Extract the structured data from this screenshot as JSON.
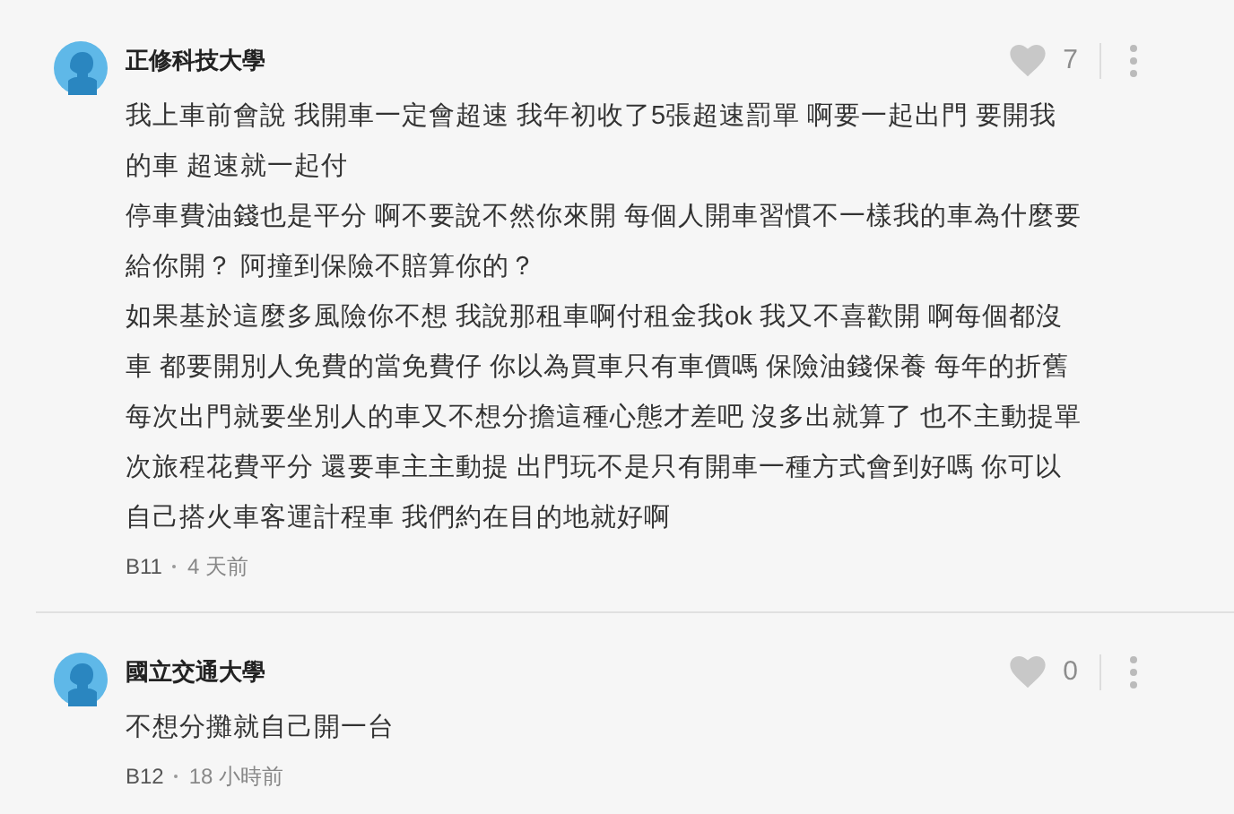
{
  "comments": [
    {
      "author": "正修科技大學",
      "likes": "7",
      "liked": false,
      "lines": [
        "我上車前會說 我開車一定會超速 我年初收了5張超速罰單 啊要一起出門 要開我",
        "的車 超速就一起付",
        "停車費油錢也是平分 啊不要說不然你來開 每個人開車習慣不一樣我的車為什麼要",
        "給你開？ 阿撞到保險不賠算你的？",
        "如果基於這麼多風險你不想 我說那租車啊付租金我ok 我又不喜歡開 啊每個都沒",
        "車 都要開別人免費的當免費仔 你以為買車只有車價嗎 保險油錢保養 每年的折舊",
        "每次出門就要坐別人的車又不想分擔這種心態才差吧 沒多出就算了 也不主動提單",
        "次旅程花費平分 還要車主主動提 出門玩不是只有開車一種方式會到好嗎 你可以",
        "自己搭火車客運計程車 我們約在目的地就好啊"
      ],
      "floor": "B11",
      "time": "4 天前"
    },
    {
      "author": "國立交通大學",
      "likes": "0",
      "liked": false,
      "lines": [
        "不想分攤就自己開一台"
      ],
      "floor": "B12",
      "time": "18 小時前"
    }
  ]
}
